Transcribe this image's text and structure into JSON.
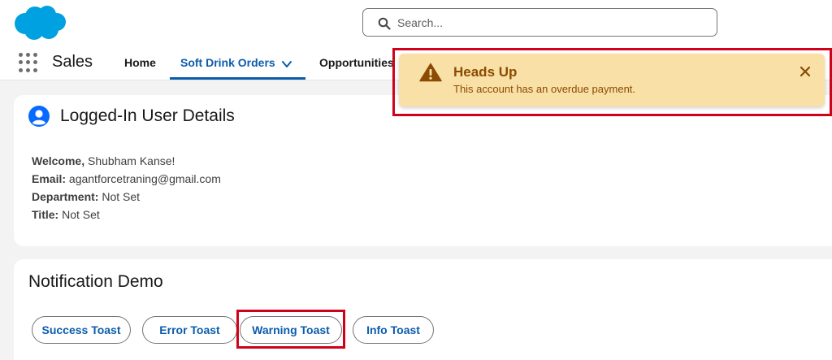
{
  "header": {
    "logo_icon": "salesforce-cloud-logo",
    "search": {
      "placeholder": "Search...",
      "value": ""
    }
  },
  "nav": {
    "app_name": "Sales",
    "items": [
      {
        "label": "Home"
      },
      {
        "label": "Soft Drink Orders",
        "active": true
      },
      {
        "label": "Opportunities"
      }
    ]
  },
  "user_card": {
    "title": "Logged-In User Details",
    "icon": "user-avatar-icon",
    "details": [
      {
        "label": "Welcome,",
        "value": "Shubham Kanse!"
      },
      {
        "label": "Email:",
        "value": "agantforcetraning@gmail.com"
      },
      {
        "label": "Department:",
        "value": "Not Set"
      },
      {
        "label": "Title:",
        "value": "Not Set"
      }
    ]
  },
  "notification_card": {
    "title": "Notification Demo",
    "buttons": [
      {
        "label": "Success Toast"
      },
      {
        "label": "Error Toast"
      },
      {
        "label": "Warning Toast"
      },
      {
        "label": "Info Toast"
      }
    ]
  },
  "toast": {
    "variant": "warning",
    "title": "Heads Up",
    "message": "This account has an overdue payment.",
    "background": "#f8e0a6",
    "text_color": "#8c4b02"
  },
  "colors": {
    "accent": "#0b5cab",
    "highlight": "#d0021b",
    "brand": "#00a1e0"
  }
}
